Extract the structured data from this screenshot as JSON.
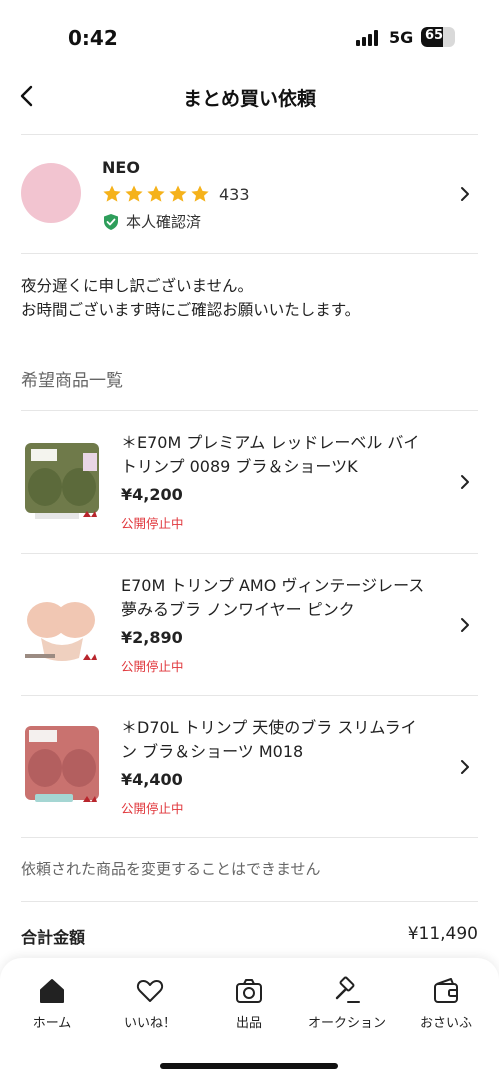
{
  "status_bar": {
    "time": "0:42",
    "network": "5G",
    "battery": "65",
    "battery_level": 0.65
  },
  "nav": {
    "title": "まとめ買い依頼",
    "back_icon": "chevron-left-icon"
  },
  "user": {
    "name": "NEO",
    "rating_stars": 5,
    "rating_count": "433",
    "verified_label": "本人確認済",
    "avatar_color": "#f2c4d0",
    "star_color": "#f5b21b",
    "verified_color": "#2e9e5b"
  },
  "message": {
    "line1": "夜分遅くに申し訳ございません。",
    "line2": "お時間ございます時にご確認お願いいたします。"
  },
  "section": {
    "title": "希望商品一覧"
  },
  "products": [
    {
      "title": "＊E70M プレミアム レッドレーベル バイ トリンプ 0089 ブラ＆ショーツK",
      "price": "¥4,200",
      "status": "公開停止中",
      "thumb_color": "#6f7a4a"
    },
    {
      "title": "E70M トリンプ AMO ヴィンテージレース 夢みるブラ ノンワイヤー ピンク",
      "price": "¥2,890",
      "status": "公開停止中",
      "thumb_color": "#f1c7b3"
    },
    {
      "title": "＊D70L トリンプ 天使のブラ スリムライン ブラ＆ショーツ M018",
      "price": "¥4,400",
      "status": "公開停止中",
      "thumb_color": "#c9726f"
    }
  ],
  "notice": "依頼された商品を変更することはできません",
  "total": {
    "label": "合計金額",
    "value": "¥11,490"
  },
  "tabs": [
    {
      "label": "ホーム",
      "icon": "home-icon"
    },
    {
      "label": "いいね！",
      "icon": "heart-icon"
    },
    {
      "label": "出品",
      "icon": "camera-icon"
    },
    {
      "label": "オークション",
      "icon": "gavel-icon"
    },
    {
      "label": "おさいふ",
      "icon": "wallet-icon"
    }
  ]
}
